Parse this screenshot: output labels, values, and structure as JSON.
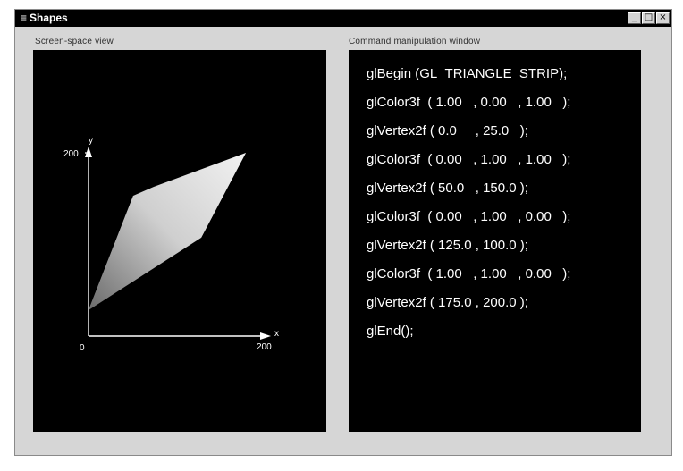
{
  "window": {
    "title": "Shapes",
    "title_icon": "app-icon"
  },
  "left_panel": {
    "label": "Screen-space view",
    "axes": {
      "y_label": "y",
      "x_label": "x",
      "y_max": "200",
      "x_max": "200",
      "origin": "0"
    }
  },
  "right_panel": {
    "label": "Command manipulation window",
    "code": [
      "glBegin (GL_TRIANGLE_STRIP);",
      "glColor3f  ( 1.00   , 0.00   , 1.00   );",
      "glVertex2f ( 0.0     , 25.0   );",
      "glColor3f  ( 0.00   , 1.00   , 1.00   );",
      "glVertex2f ( 50.0   , 150.0 );",
      "glColor3f  ( 0.00   , 1.00   , 0.00   );",
      "glVertex2f ( 125.0 , 100.0 );",
      "glColor3f  ( 1.00   , 1.00   , 0.00   );",
      "glVertex2f ( 175.0 , 200.0 );",
      "glEnd();"
    ]
  },
  "colors": {
    "titlebar": "#000000",
    "panel": "#000000",
    "window_bg": "#d6d6d6"
  }
}
